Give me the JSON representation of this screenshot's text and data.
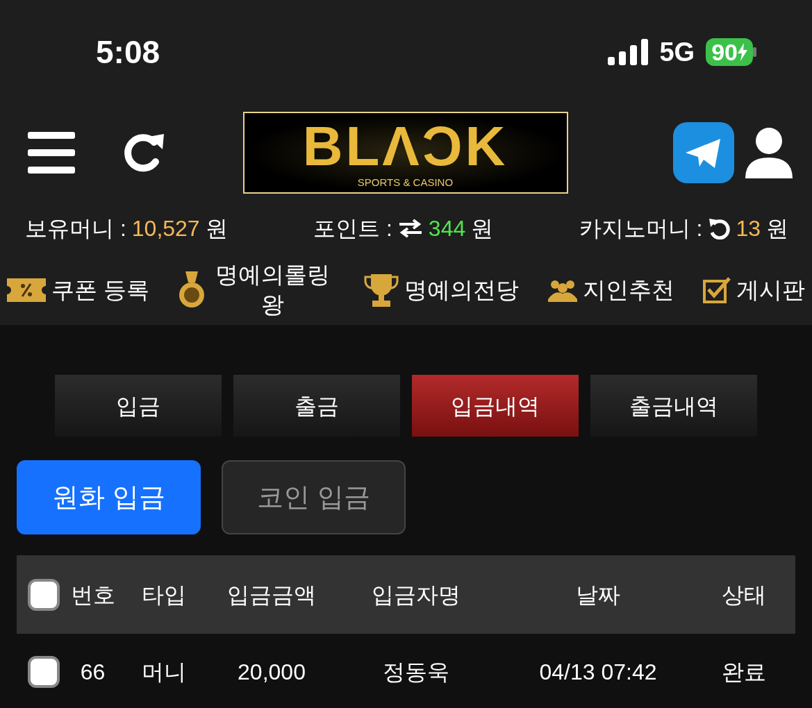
{
  "status_bar": {
    "time": "5:08",
    "network": "5G",
    "battery": "90"
  },
  "header": {
    "logo": "BLΛƆK",
    "logo_subtitle": "SPORTS & CASINO"
  },
  "balances": [
    {
      "label": "보유머니 :",
      "amount": "10,527",
      "unit": "원",
      "color": "#f6b957"
    },
    {
      "label": "포인트 :",
      "amount": "344",
      "unit": "원",
      "color": "#4fe64f"
    },
    {
      "label": "카지노머니 :",
      "amount": "13",
      "unit": "원",
      "color": "#f6b957"
    }
  ],
  "menu": [
    {
      "label": "쿠폰 등록"
    },
    {
      "label": "명예의롤링왕"
    },
    {
      "label": "명예의전당"
    },
    {
      "label": "지인추천"
    },
    {
      "label": "게시판"
    }
  ],
  "tabs": [
    {
      "label": "입금",
      "selected": false
    },
    {
      "label": "출금",
      "selected": false
    },
    {
      "label": "입금내역",
      "selected": true
    },
    {
      "label": "출금내역",
      "selected": false
    }
  ],
  "deposit_types": [
    {
      "label": "원화 입금",
      "selected": true
    },
    {
      "label": "코인 입금",
      "selected": false
    }
  ],
  "table": {
    "header_checked": false,
    "columns": [
      "번호",
      "타입",
      "입금금액",
      "입금자명",
      "날짜",
      "상태"
    ],
    "rows": [
      {
        "checked": false,
        "cells": [
          "66",
          "머니",
          "20,000",
          "정동욱",
          "04/13 07:42",
          "완료"
        ]
      }
    ]
  }
}
